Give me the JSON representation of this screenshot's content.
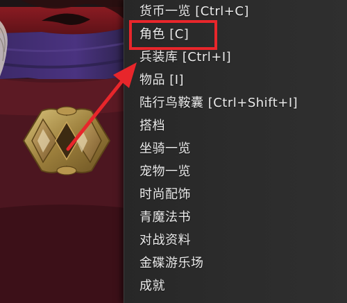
{
  "menu": {
    "items": [
      {
        "label": "货币一览 [Ctrl+C]"
      },
      {
        "label": "角色 [C]"
      },
      {
        "label": "兵装库 [Ctrl+I]"
      },
      {
        "label": "物品 [I]"
      },
      {
        "label": "陆行鸟鞍囊 [Ctrl+Shift+I]"
      },
      {
        "label": "搭档"
      },
      {
        "label": "坐骑一览"
      },
      {
        "label": "宠物一览"
      },
      {
        "label": "时尚配饰"
      },
      {
        "label": "青魔法书"
      },
      {
        "label": "对战资料"
      },
      {
        "label": "金碟游乐场"
      },
      {
        "label": "成就"
      }
    ]
  },
  "annotation": {
    "box_color": "#e8262b",
    "arrow_color": "#e8262b"
  }
}
